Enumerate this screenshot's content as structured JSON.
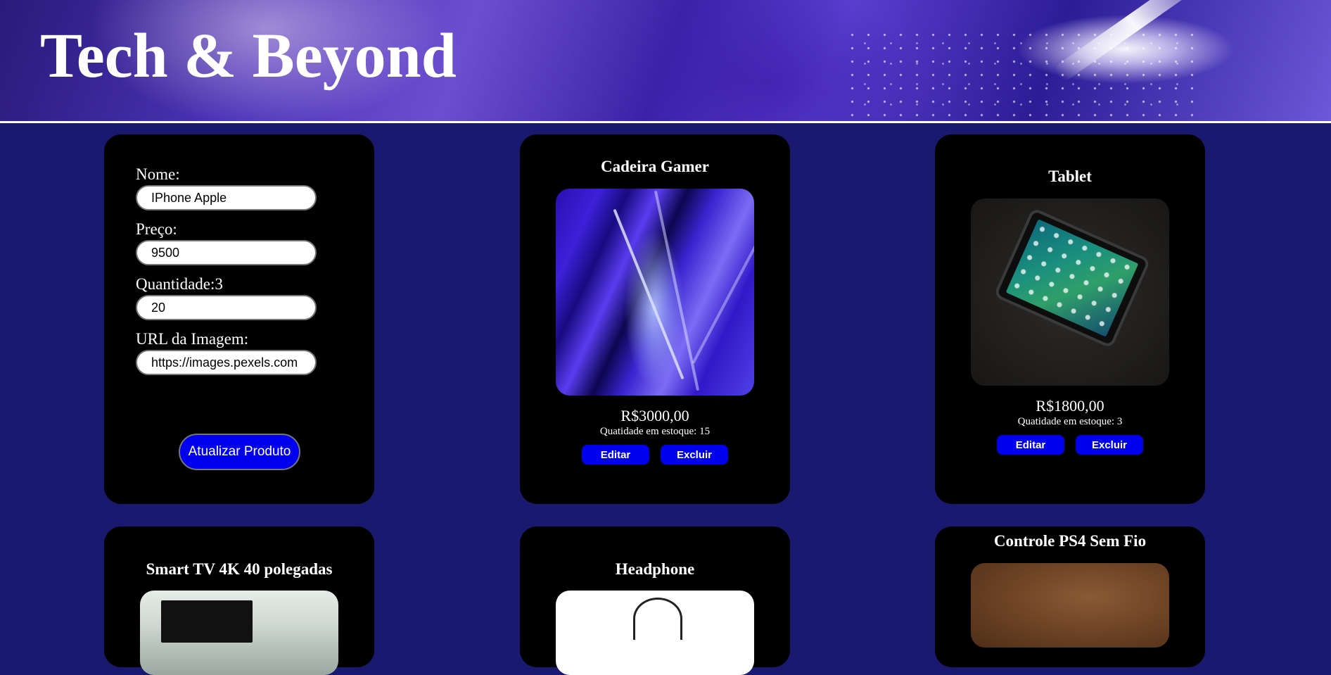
{
  "header": {
    "title": "Tech & Beyond"
  },
  "form": {
    "name_label": "Nome:",
    "name_value": "IPhone Apple",
    "price_label": "Preço:",
    "price_value": "9500",
    "quantity_label": "Quantidade:3",
    "quantity_value": "20",
    "image_url_label": "URL da Imagem:",
    "image_url_value": "https://images.pexels.com",
    "submit_label": "Atualizar Produto"
  },
  "products": [
    {
      "title": "Cadeira Gamer",
      "price": "R$3000,00",
      "stock": "Quatidade em estoque: 15",
      "edit_label": "Editar",
      "delete_label": "Excluir"
    },
    {
      "title": "Tablet",
      "price": "R$1800,00",
      "stock": "Quatidade em estoque: 3",
      "edit_label": "Editar",
      "delete_label": "Excluir"
    },
    {
      "title": "Smart TV 4K 40 polegadas"
    },
    {
      "title": "Headphone"
    },
    {
      "title": "Controle PS4 Sem Fio"
    }
  ],
  "colors": {
    "page_background": "#191970",
    "card_background": "#000000",
    "button_primary": "#0000ee"
  }
}
